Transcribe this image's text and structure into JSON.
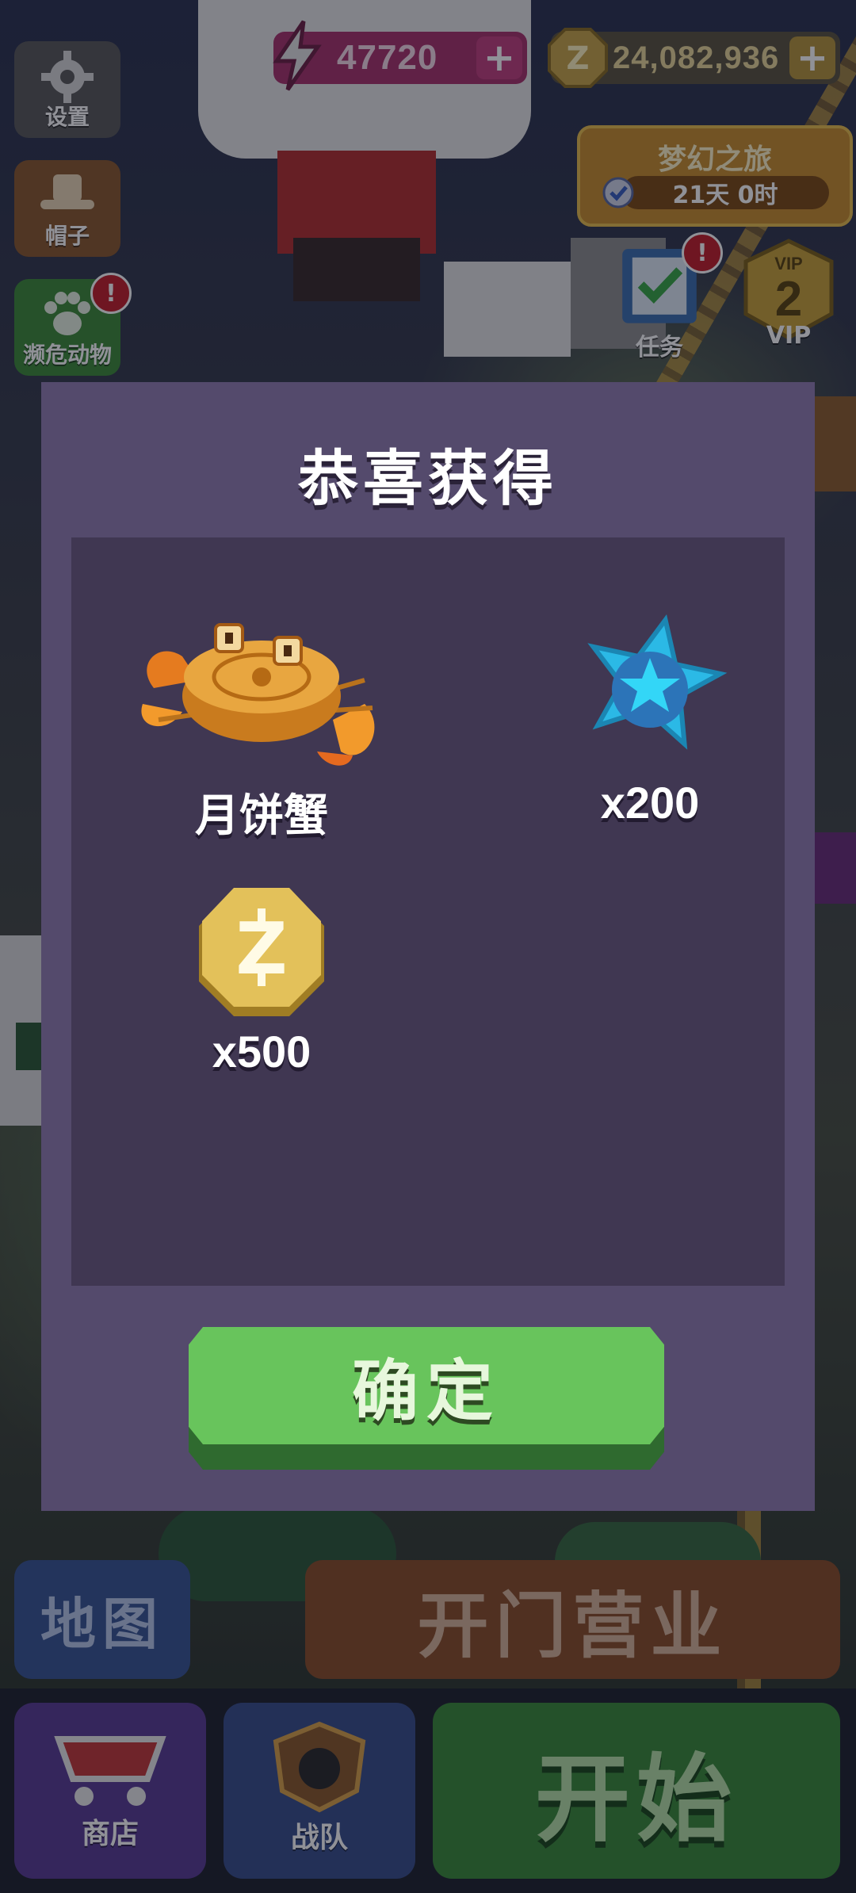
{
  "hud": {
    "energy_value": "47720",
    "coin_value": "24,082,936",
    "plus_symbol": "+"
  },
  "left_menu": [
    {
      "label": "设置",
      "icon": "gear-icon"
    },
    {
      "label": "帽子",
      "icon": "hat-icon"
    },
    {
      "label": "濒危动物",
      "icon": "paw-icon",
      "badge": "!"
    }
  ],
  "event": {
    "title": "梦幻之旅",
    "timer": "21天 0时"
  },
  "right_menu": [
    {
      "label": "任务",
      "icon": "checklist-icon",
      "badge": "!"
    },
    {
      "label": "VIP",
      "icon": "vip-shield-icon",
      "level": "2"
    }
  ],
  "dialog": {
    "title": "恭喜获得",
    "confirm_label": "确定",
    "rewards": [
      {
        "label": "月饼蟹",
        "icon": "mooncake-crab-icon"
      },
      {
        "label": "x200",
        "icon": "blue-star-icon"
      },
      {
        "label": "x500",
        "icon": "z-coin-icon"
      }
    ]
  },
  "bottom": {
    "map_label": "地图",
    "open_label": "开门营业",
    "shop_label": "商店",
    "team_label": "战队",
    "start_label": "开始"
  },
  "colors": {
    "dialog_bg": "#544a6c",
    "panel_bg": "#403752",
    "confirm_green": "#68c45c",
    "energy_pink": "#a8336c"
  }
}
